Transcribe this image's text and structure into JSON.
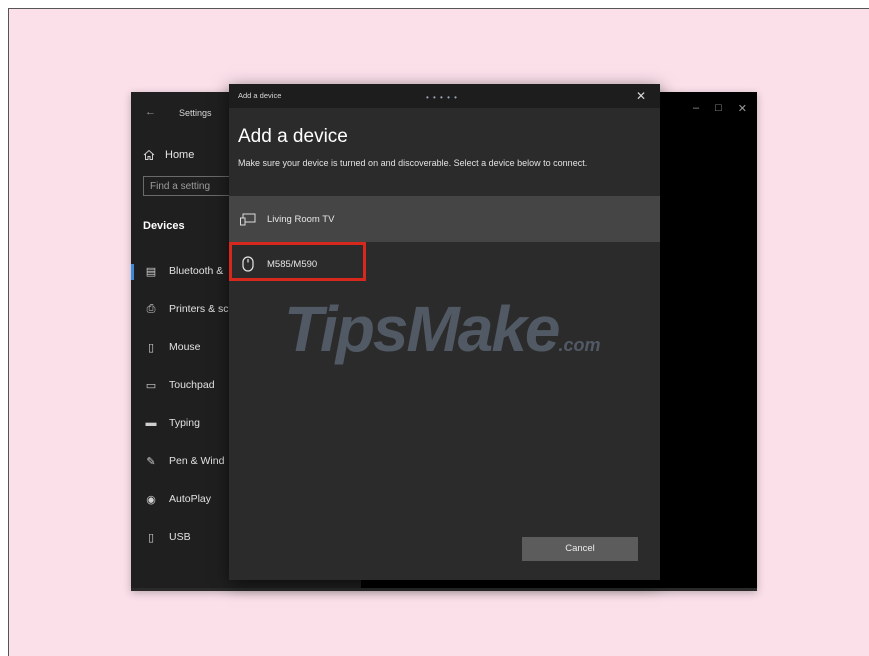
{
  "settings_window": {
    "back_glyph": "←",
    "title": "Settings",
    "controls": [
      "–",
      "□",
      "✕"
    ],
    "home_label": "Home",
    "search_placeholder": "Find a setting",
    "section_heading": "Devices",
    "nav_items": [
      {
        "label": "Bluetooth &",
        "icon": "bluetooth-devices-icon",
        "active": true
      },
      {
        "label": "Printers & sc",
        "icon": "printer-icon"
      },
      {
        "label": "Mouse",
        "icon": "mouse-icon"
      },
      {
        "label": "Touchpad",
        "icon": "touchpad-icon"
      },
      {
        "label": "Typing",
        "icon": "keyboard-icon"
      },
      {
        "label": "Pen & Wind",
        "icon": "pen-icon"
      },
      {
        "label": "AutoPlay",
        "icon": "autoplay-icon"
      },
      {
        "label": "USB",
        "icon": "usb-icon"
      }
    ]
  },
  "dialog": {
    "titlebar_text": "Add a device",
    "title_dots": "• • • • •",
    "close_glyph": "✕",
    "heading": "Add a device",
    "description": "Make sure your device is turned on and discoverable. Select a device below to connect.",
    "devices": [
      {
        "name": "Living Room TV",
        "icon": "display-icon"
      },
      {
        "name": "M585/M590",
        "icon": "mouse-icon"
      }
    ],
    "cancel_label": "Cancel"
  },
  "watermark": {
    "main": "TipsMake",
    "suffix": ".com"
  },
  "colors": {
    "highlight": "#d6281c",
    "accent": "#3a8ad8",
    "background": "#fbe0ea"
  }
}
